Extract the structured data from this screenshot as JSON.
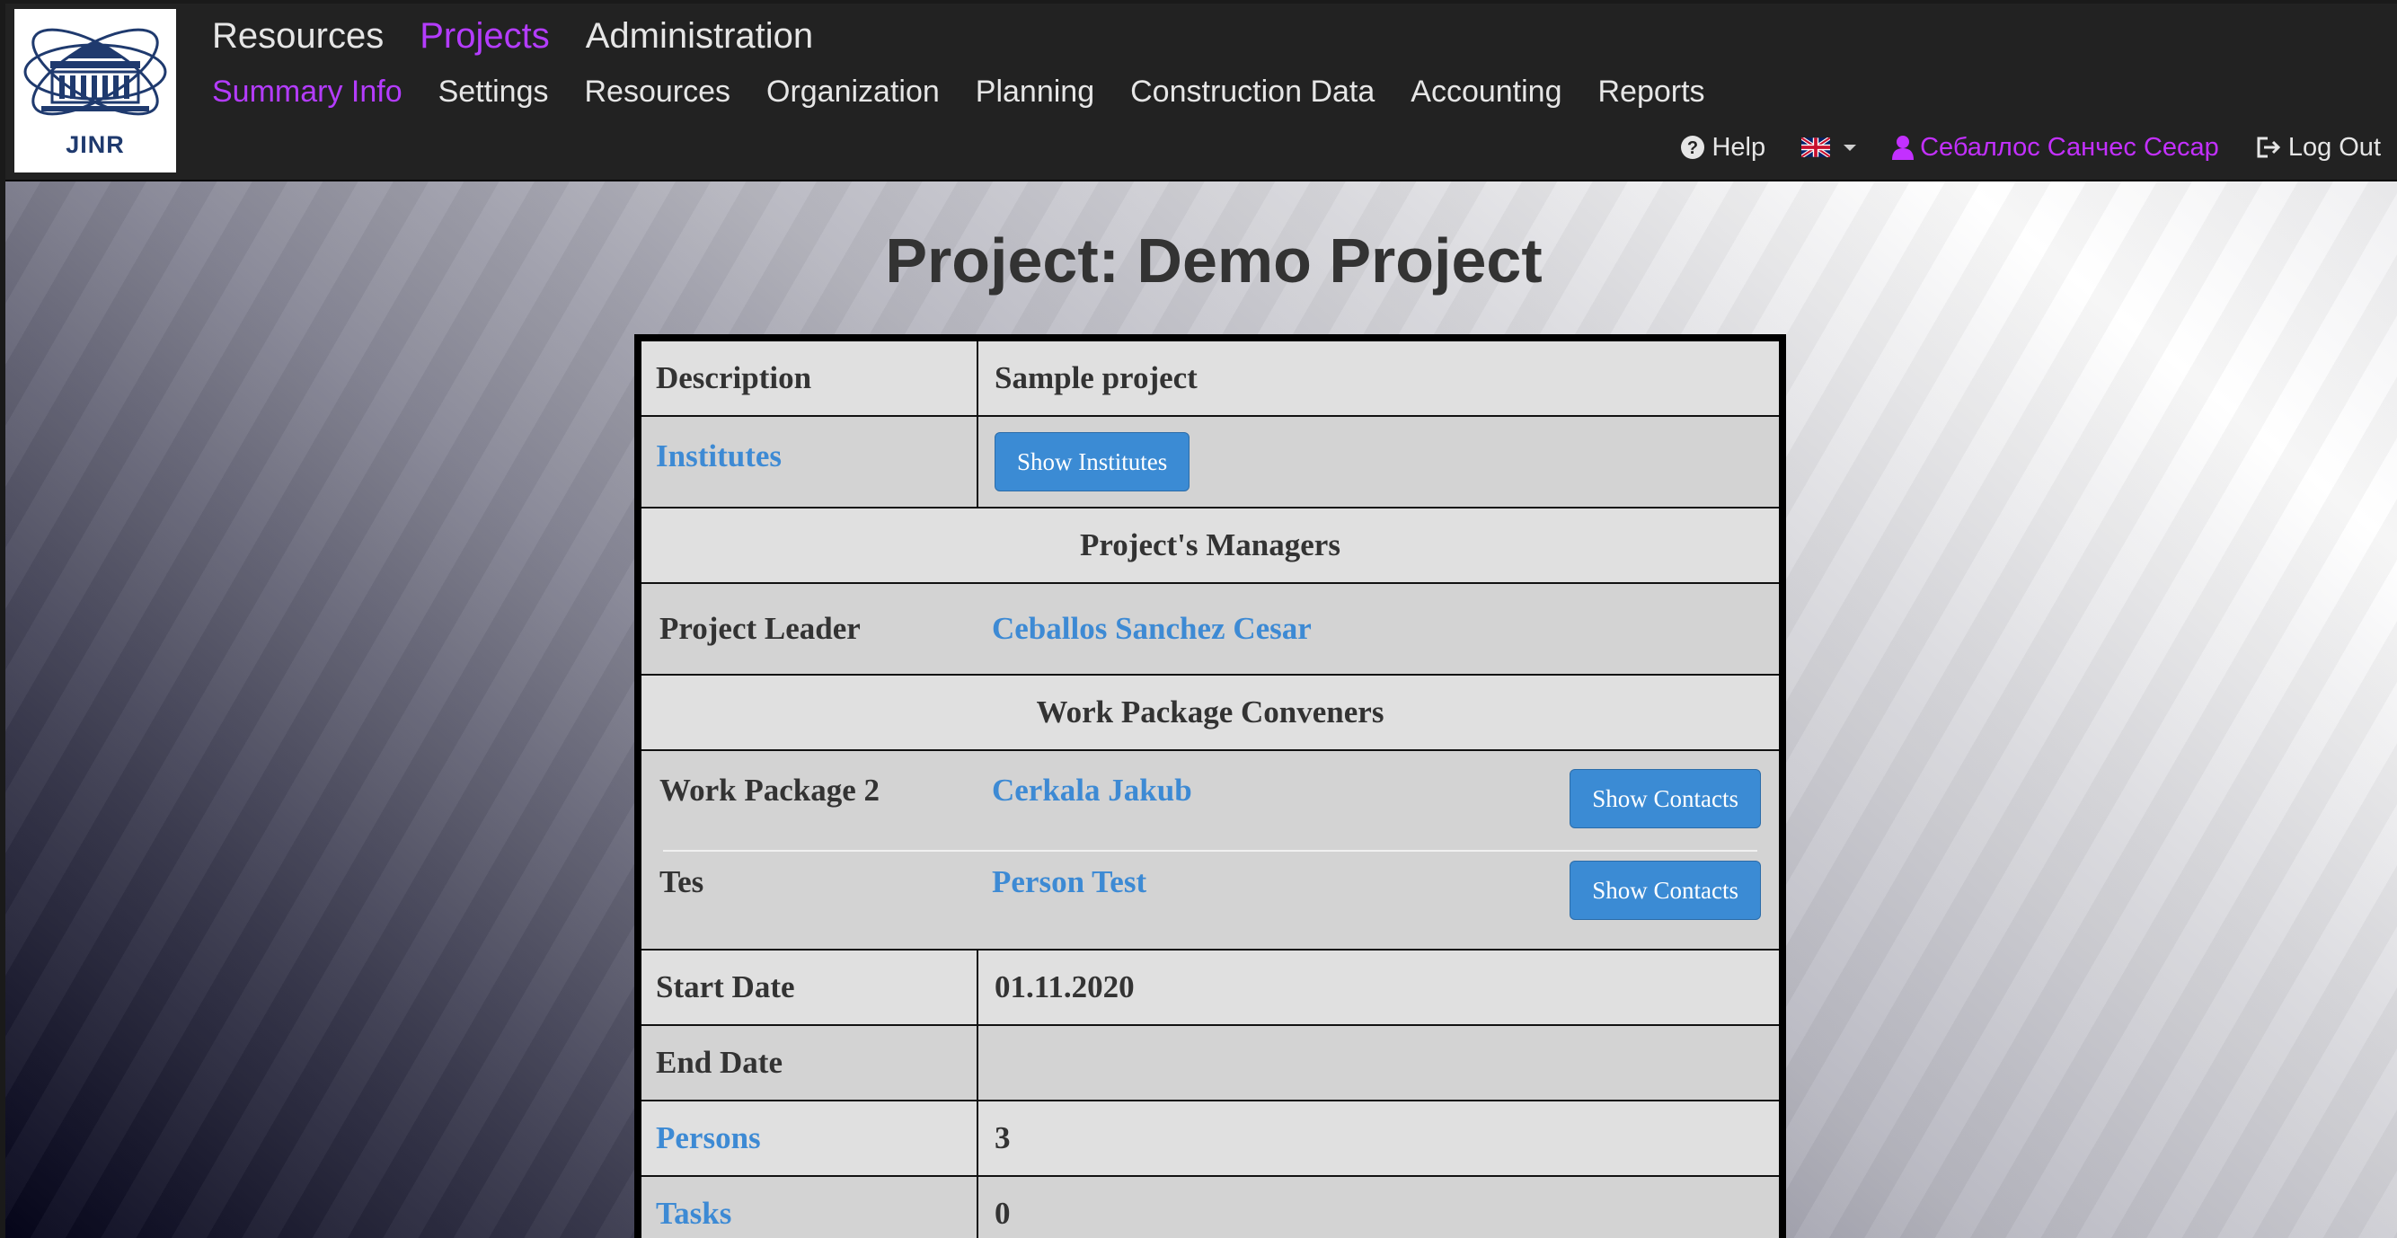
{
  "logo": {
    "text": "JINR"
  },
  "nav": {
    "top": [
      {
        "label": "Resources",
        "active": false
      },
      {
        "label": "Projects",
        "active": true
      },
      {
        "label": "Administration",
        "active": false
      }
    ],
    "sub": [
      {
        "label": "Summary Info",
        "active": true
      },
      {
        "label": "Settings",
        "active": false
      },
      {
        "label": "Resources",
        "active": false
      },
      {
        "label": "Organization",
        "active": false
      },
      {
        "label": "Planning",
        "active": false
      },
      {
        "label": "Construction Data",
        "active": false
      },
      {
        "label": "Accounting",
        "active": false
      },
      {
        "label": "Reports",
        "active": false
      }
    ],
    "help_label": "Help",
    "language_icon": "uk-flag-icon",
    "user_name": "Себаллос Санчес Сесар",
    "logout_label": "Log Out"
  },
  "colors": {
    "active": "#b43cff",
    "link": "#3d8ad4",
    "button": "#3b8bd4"
  },
  "page": {
    "title": "Project: Demo Project"
  },
  "details": {
    "description_label": "Description",
    "description_value": "Sample project",
    "institutes_label": "Institutes",
    "show_institutes": "Show Institutes",
    "managers_header": "Project's Managers",
    "leader_label": "Project Leader",
    "leader_name": "Ceballos Sanchez Cesar",
    "conveners_header": "Work Package Conveners",
    "work_packages": [
      {
        "name": "Work Package 2",
        "convener": "Cerkala Jakub",
        "button": "Show Contacts"
      },
      {
        "name": "Tes",
        "convener": "Person Test",
        "button": "Show Contacts"
      }
    ],
    "start_date_label": "Start Date",
    "start_date_value": "01.11.2020",
    "end_date_label": "End Date",
    "end_date_value": "",
    "persons_label": "Persons",
    "persons_value": "3",
    "tasks_label": "Tasks",
    "tasks_value": "0"
  }
}
